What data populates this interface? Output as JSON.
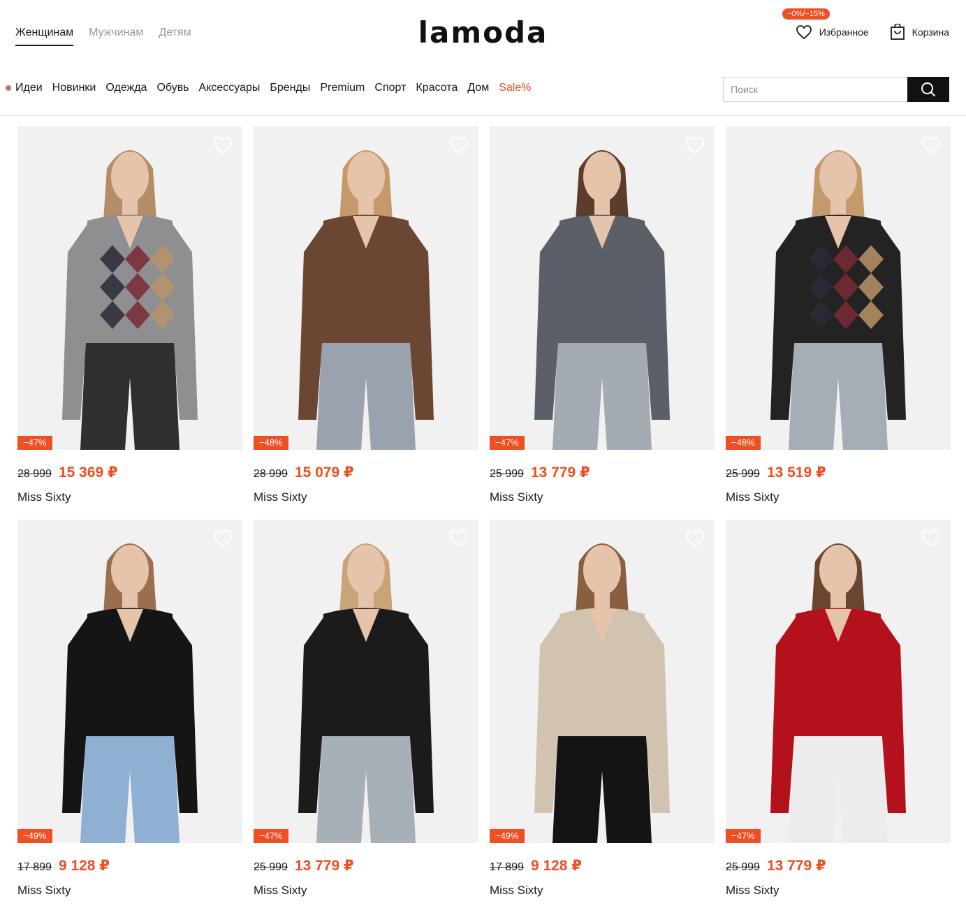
{
  "header": {
    "logo": "lamoda",
    "gender_tabs": [
      "Женщинам",
      "Мужчинам",
      "Детям"
    ],
    "active_gender": "Женщинам",
    "promo_badge": "−0%/−15%",
    "favorites_label": "Избранное",
    "cart_label": "Корзина"
  },
  "menu": {
    "items": [
      "Идеи",
      "Новинки",
      "Одежда",
      "Обувь",
      "Аксессуары",
      "Бренды",
      "Premium",
      "Спорт",
      "Красота",
      "Дом",
      "Sale%"
    ]
  },
  "search": {
    "placeholder": "Поиск"
  },
  "products": [
    {
      "discount": "−47%",
      "old_price": "28 999",
      "new_price": "15 369 ₽",
      "brand": "Miss Sixty",
      "top_color": "#8f8f91",
      "bottom_color": "#2f2f31",
      "hair_color": "#b48c66",
      "pattern": "argyle"
    },
    {
      "discount": "−48%",
      "old_price": "28 999",
      "new_price": "15 079 ₽",
      "brand": "Miss Sixty",
      "top_color": "#6b4632",
      "bottom_color": "#9aa3ad",
      "hair_color": "#c49a6c",
      "pattern": "plain"
    },
    {
      "discount": "−47%",
      "old_price": "25 999",
      "new_price": "13 779 ₽",
      "brand": "Miss Sixty",
      "top_color": "#5b5f68",
      "bottom_color": "#a3aab2",
      "hair_color": "#5a3e2b",
      "pattern": "plain"
    },
    {
      "discount": "−48%",
      "old_price": "25 999",
      "new_price": "13 519 ₽",
      "brand": "Miss Sixty",
      "top_color": "#232323",
      "bottom_color": "#a5adb5",
      "hair_color": "#c49a6c",
      "pattern": "argyle-vest"
    },
    {
      "discount": "−49%",
      "old_price": "17 899",
      "new_price": "9 128 ₽",
      "brand": "Miss Sixty",
      "top_color": "#151515",
      "bottom_color": "#8fb0d3",
      "hair_color": "#9a6f4e",
      "pattern": "plain"
    },
    {
      "discount": "−47%",
      "old_price": "25 999",
      "new_price": "13 779 ₽",
      "brand": "Miss Sixty",
      "top_color": "#1b1b1b",
      "bottom_color": "#a8b0b7",
      "hair_color": "#c9a477",
      "pattern": "plain"
    },
    {
      "discount": "−49%",
      "old_price": "17 899",
      "new_price": "9 128 ₽",
      "brand": "Miss Sixty",
      "top_color": "#d2c2b0",
      "bottom_color": "#141414",
      "hair_color": "#8a5f40",
      "pattern": "plain"
    },
    {
      "discount": "−47%",
      "old_price": "25 999",
      "new_price": "13 779 ₽",
      "brand": "Miss Sixty",
      "top_color": "#b3121c",
      "bottom_color": "#ececec",
      "hair_color": "#6a4630",
      "pattern": "plain"
    }
  ]
}
